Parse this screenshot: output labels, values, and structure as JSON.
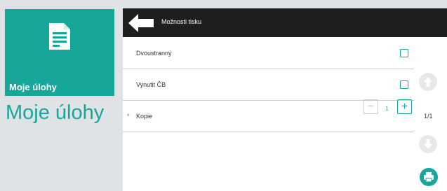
{
  "tile": {
    "label": "Moje úlohy",
    "icon": "document-icon"
  },
  "page_title": "Moje úlohy",
  "header": {
    "title": "Možnosti tisku",
    "back_icon": "back-arrow-icon"
  },
  "options": [
    {
      "label": "Dvoustranný",
      "checked": false
    },
    {
      "label": "Vynutit ČB",
      "checked": false
    }
  ],
  "copies": {
    "required_mark": "*",
    "label": "Kopie",
    "value": "1",
    "minus": "−",
    "plus": "+"
  },
  "pagination": {
    "indicator": "1/1"
  },
  "colors": {
    "accent": "#17a79a",
    "header_bg": "#1e1e1e",
    "background": "#dfe3e6"
  }
}
